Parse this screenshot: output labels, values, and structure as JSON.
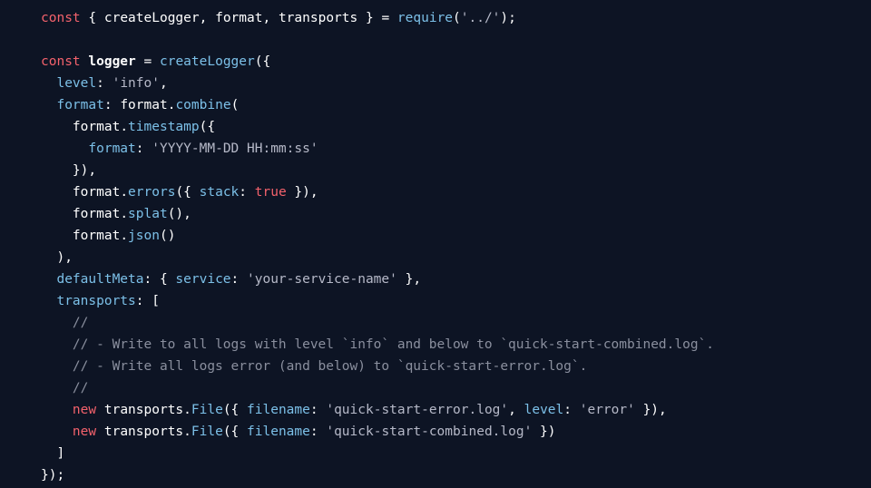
{
  "code": {
    "t": {
      "const": "const",
      "new": "new",
      "require": "require",
      "createLogger": "createLogger",
      "format": "format",
      "transports": "transports",
      "logger": "logger",
      "combine": "combine",
      "timestamp": "timestamp",
      "errors": "errors",
      "splat": "splat",
      "json": "json",
      "File": "File",
      "level": "level",
      "formatKey": "format",
      "defaultMeta": "defaultMeta",
      "service": "service",
      "transportsKey": "transports",
      "stack": "stack",
      "filename": "filename",
      "true": "true"
    },
    "s": {
      "modulePath": "'../'",
      "info": "'info'",
      "tsFormat": "'YYYY-MM-DD HH:mm:ss'",
      "serviceName": "'your-service-name'",
      "errorLog": "'quick-start-error.log'",
      "error": "'error'",
      "combinedLog": "'quick-start-combined.log'"
    },
    "c": {
      "slash1": "//",
      "line1": "// - Write to all logs with level `info` and below to `quick-start-combined.log`.",
      "line2": "// - Write all logs error (and below) to `quick-start-error.log`.",
      "slash2": "//"
    }
  }
}
